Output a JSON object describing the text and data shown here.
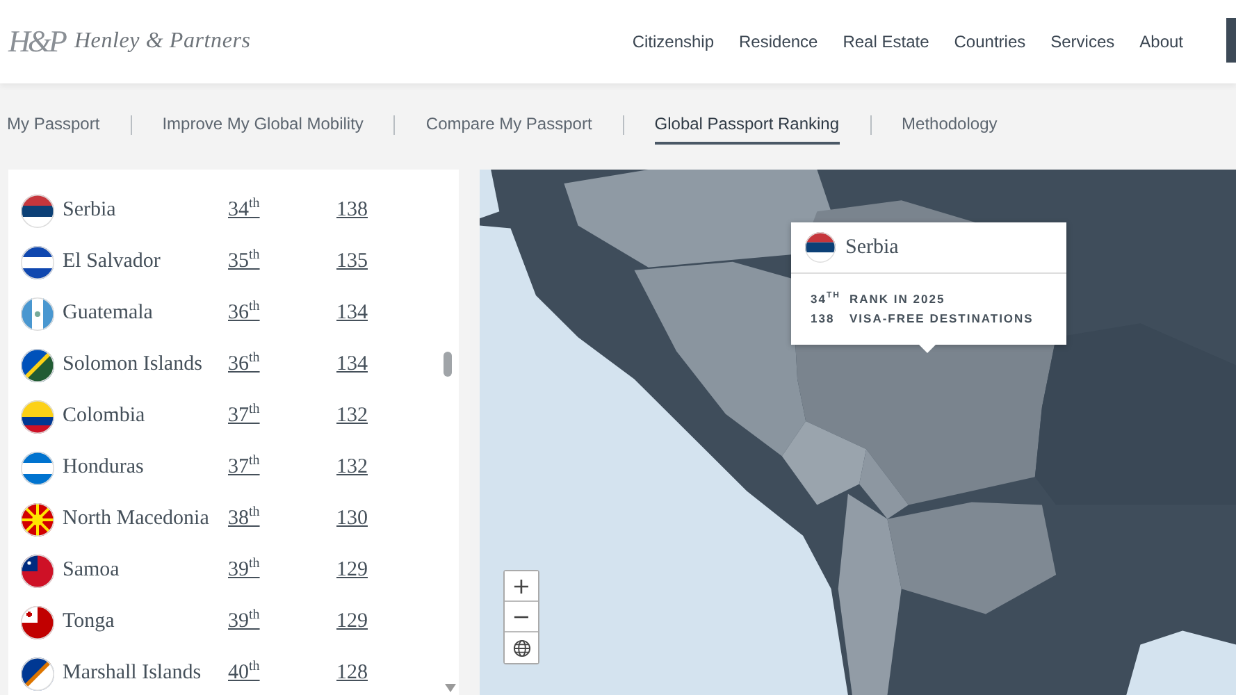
{
  "header": {
    "logo_mark": "H&P",
    "brand": "Henley & Partners",
    "nav": [
      "Citizenship",
      "Residence",
      "Real Estate",
      "Countries",
      "Services",
      "About"
    ]
  },
  "tabs": [
    {
      "label": "My Passport",
      "selected": false
    },
    {
      "label": "Improve My Global Mobility",
      "selected": false
    },
    {
      "label": "Compare My Passport",
      "selected": false
    },
    {
      "label": "Global Passport Ranking",
      "selected": true
    },
    {
      "label": "Methodology",
      "selected": false
    }
  ],
  "ranking": [
    {
      "country": "Serbia",
      "rank": "34$^{th}$",
      "visa_free": "138"
    },
    {
      "country": "El Salvador",
      "rank": "35$^{th}$",
      "visa_free": "135"
    },
    {
      "country": "Guatemala",
      "rank": "36$^{th}$",
      "visa_free": "134"
    },
    {
      "country": "Solomon Islands",
      "rank": "36$^{th}$",
      "visa_free": "134"
    },
    {
      "country": "Colombia",
      "rank": "37$^{th}$",
      "visa_free": "132"
    },
    {
      "country": "Honduras",
      "rank": "37$^{th}$",
      "visa_free": "132"
    },
    {
      "country": "North Macedonia",
      "rank": "38$^{th}$",
      "visa_free": "130"
    },
    {
      "country": "Samoa",
      "rank": "39$^{th}$",
      "visa_free": "129"
    },
    {
      "country": "Tonga",
      "rank": "39$^{th}$",
      "visa_free": "129"
    },
    {
      "country": "Marshall Islands",
      "rank": "40$^{th}$",
      "visa_free": "128"
    }
  ],
  "map": {
    "kind": "picture",
    "tooltip": {
      "country": "Serbia",
      "rank": "34$^{TH}$",
      "rank_label": "RANK IN 2025",
      "visa_free": "138",
      "visa_label": "VISA-FREE DESTINATIONS"
    },
    "zoom_in": "+",
    "zoom_out": "−"
  }
}
